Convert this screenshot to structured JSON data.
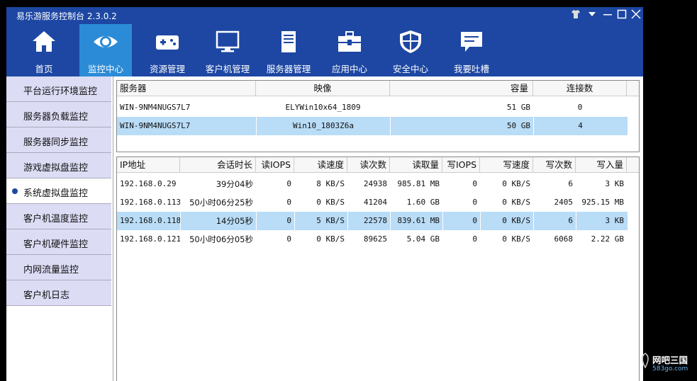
{
  "app": {
    "title": "易乐游服务控制台 2.3.0.2"
  },
  "nav": [
    {
      "label": "首页",
      "icon": "home-icon"
    },
    {
      "label": "监控中心",
      "icon": "eye-icon"
    },
    {
      "label": "资源管理",
      "icon": "gamepad-icon"
    },
    {
      "label": "客户机管理",
      "icon": "monitor-icon"
    },
    {
      "label": "服务器管理",
      "icon": "server-icon"
    },
    {
      "label": "应用中心",
      "icon": "toolbox-icon"
    },
    {
      "label": "安全中心",
      "icon": "shield-icon"
    },
    {
      "label": "我要吐槽",
      "icon": "message-icon"
    }
  ],
  "sidebar": [
    {
      "label": "平台运行环境监控"
    },
    {
      "label": "服务器负载监控"
    },
    {
      "label": "服务器同步监控"
    },
    {
      "label": "游戏虚拟盘监控"
    },
    {
      "label": "系统虚拟盘监控"
    },
    {
      "label": "客户机温度监控"
    },
    {
      "label": "客户机硬件监控"
    },
    {
      "label": "内网流量监控"
    },
    {
      "label": "客户机日志"
    }
  ],
  "servers": {
    "headers": [
      "服务器",
      "映像",
      "容量",
      "连接数"
    ],
    "rows": [
      [
        "WIN-9NM4NUGS7L7",
        "ELYWin10x64_1809",
        "51 GB",
        "0"
      ],
      [
        "WIN-9NM4NUGS7L7",
        "Win10_1803Z6a",
        "50 GB",
        "4"
      ]
    ]
  },
  "sessions": {
    "headers": [
      "IP地址",
      "会话时长",
      "读IOPS",
      "读速度",
      "读次数",
      "读取量",
      "写IOPS",
      "写速度",
      "写次数",
      "写入量"
    ],
    "rows": [
      [
        "192.168.0.29",
        "39分04秒",
        "0",
        "8 KB/S",
        "24938",
        "985.81 MB",
        "0",
        "0 KB/S",
        "6",
        "3 KB"
      ],
      [
        "192.168.0.113",
        "50小时06分25秒",
        "0",
        "0 KB/S",
        "41204",
        "1.60 GB",
        "0",
        "0 KB/S",
        "2405",
        "925.15 MB"
      ],
      [
        "192.168.0.118",
        "14分05秒",
        "0",
        "5 KB/S",
        "22578",
        "839.61 MB",
        "0",
        "0 KB/S",
        "6",
        "3 KB"
      ],
      [
        "192.168.0.121",
        "50小时06分05秒",
        "0",
        "0 KB/S",
        "89625",
        "5.04 GB",
        "0",
        "0 KB/S",
        "6068",
        "2.22 GB"
      ]
    ]
  },
  "watermark": {
    "line1": "网吧三国",
    "line2": "583go.com"
  }
}
